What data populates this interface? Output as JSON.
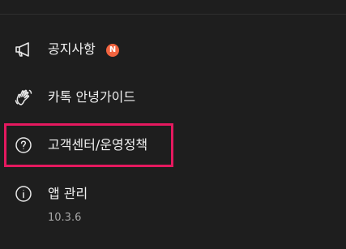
{
  "menu": {
    "items": [
      {
        "label": "공지사항",
        "icon": "megaphone-icon",
        "badge": "N"
      },
      {
        "label": "카톡 안녕가이드",
        "icon": "waving-hand-icon"
      },
      {
        "label": "고객센터/운영정책",
        "icon": "question-circle-icon"
      },
      {
        "label": "앱 관리",
        "icon": "info-circle-icon",
        "version": "10.3.6"
      }
    ]
  },
  "colors": {
    "background": "#1e1e1e",
    "text": "#f2f2f2",
    "badge": "#f2643f",
    "highlight": "#e5195f",
    "secondary_text": "#a8a8a8"
  }
}
